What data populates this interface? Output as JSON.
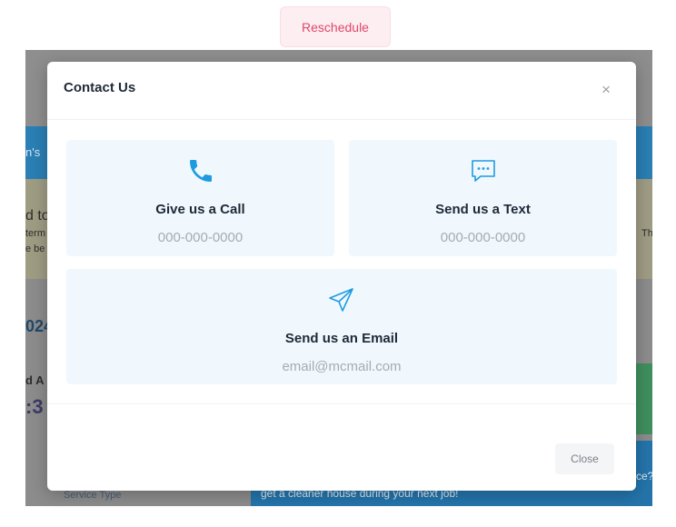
{
  "page": {
    "reschedule_label": "Reschedule"
  },
  "background": {
    "frag_left_1": "n's",
    "frag_left_2": "d to",
    "frag_left_3": "term",
    "frag_left_4": "e be",
    "frag_right_1": "Th",
    "frag_year": "024",
    "frag_name": "d A",
    "frag_time": ":3",
    "frag_right_2": "ce?",
    "service_type_label": "Service Type",
    "promo_text": "get a cleaner house during your next job!"
  },
  "modal": {
    "title": "Contact Us",
    "close_symbol": "×",
    "call": {
      "title": "Give us a Call",
      "value": "000-000-0000"
    },
    "text": {
      "title": "Send us a Text",
      "value": "000-000-0000"
    },
    "email": {
      "title": "Send us an Email",
      "value": "email@mcmail.com"
    },
    "close_label": "Close"
  },
  "colors": {
    "accent": "#1e9be0",
    "card_bg": "#f0f8fe",
    "reschedule": "#e0476b"
  }
}
